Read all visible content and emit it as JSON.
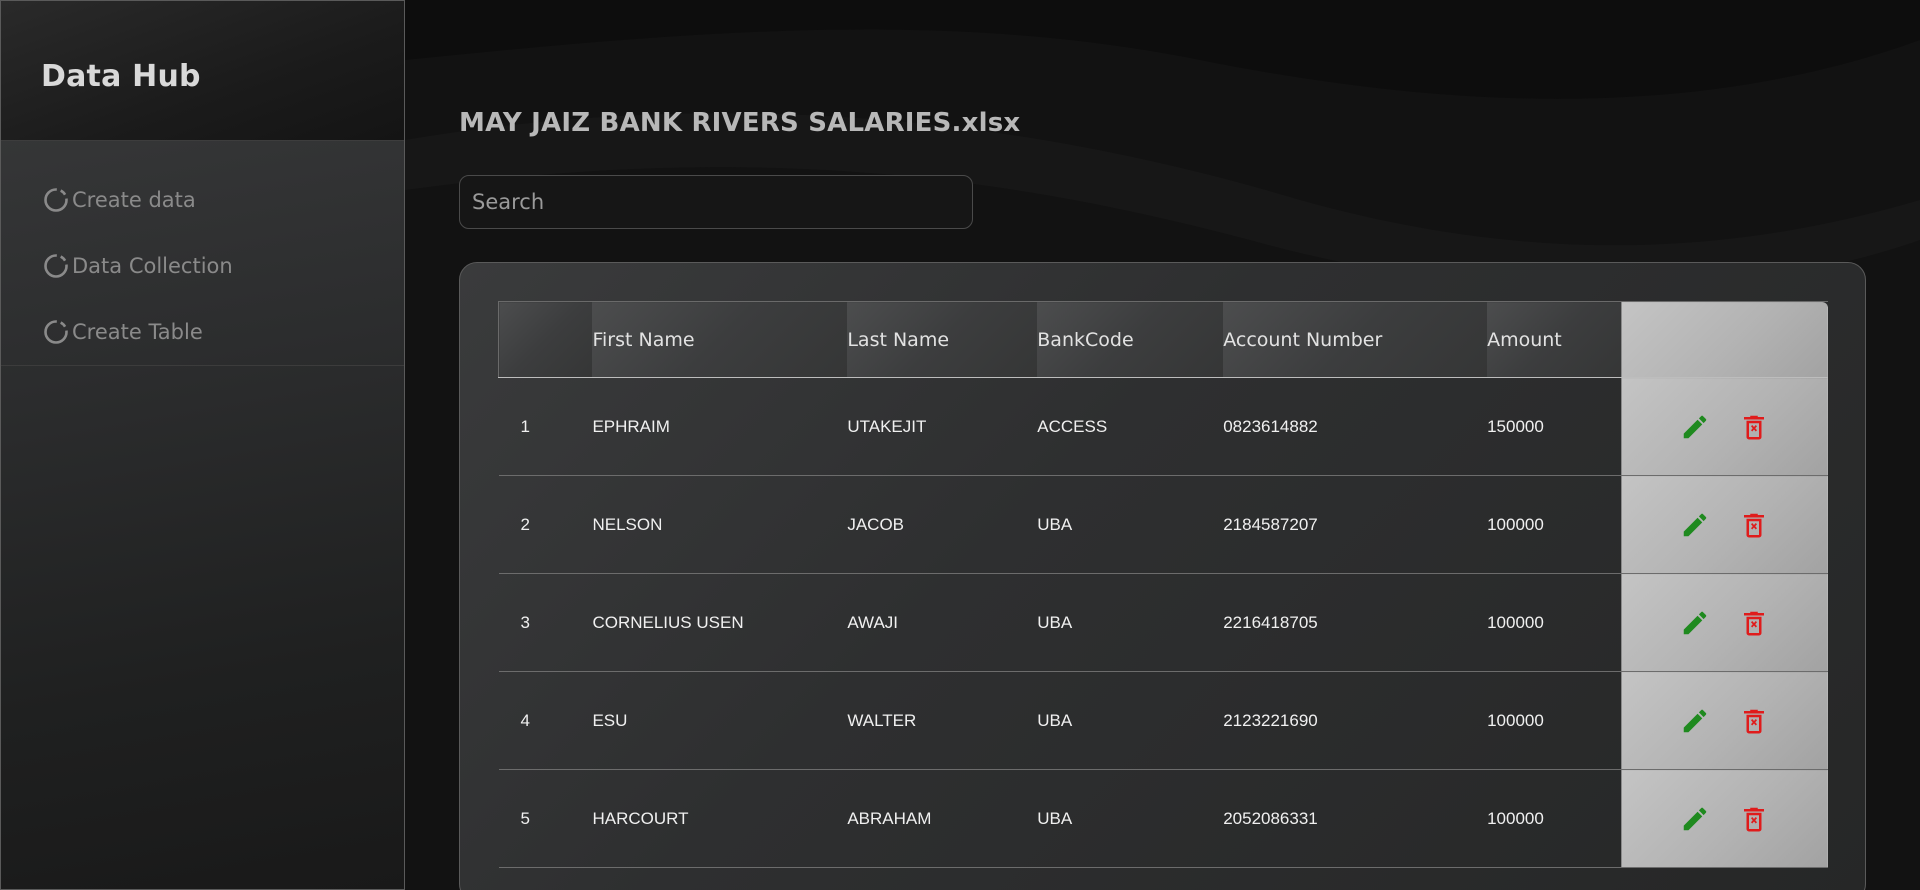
{
  "sidebar": {
    "brand": "Data Hub",
    "items": [
      {
        "label": "Create data",
        "icon": "loading-circle-icon"
      },
      {
        "label": "Data Collection",
        "icon": "loading-circle-icon"
      },
      {
        "label": "Create Table",
        "icon": "loading-circle-icon"
      }
    ]
  },
  "main": {
    "file_title": "MAY JAIZ BANK RIVERS SALARIES.xlsx",
    "search": {
      "placeholder": "Search",
      "value": ""
    },
    "table": {
      "columns": [
        "",
        "First Name",
        "Last Name",
        "BankCode",
        "Account Number",
        "Amount",
        ""
      ],
      "rows": [
        {
          "index": "1",
          "first": "EPHRAIM",
          "last": "UTAKEJIT",
          "bank": "ACCESS",
          "account": "0823614882",
          "amount": "150000"
        },
        {
          "index": "2",
          "first": "NELSON",
          "last": "JACOB",
          "bank": "UBA",
          "account": "2184587207",
          "amount": "100000"
        },
        {
          "index": "3",
          "first": "CORNELIUS USEN",
          "last": "AWAJI",
          "bank": "UBA",
          "account": "2216418705",
          "amount": "100000"
        },
        {
          "index": "4",
          "first": "ESU",
          "last": "WALTER",
          "bank": "UBA",
          "account": "2123221690",
          "amount": "100000"
        },
        {
          "index": "5",
          "first": "HARCOURT",
          "last": "ABRAHAM",
          "bank": "UBA",
          "account": "2052086331",
          "amount": "100000"
        }
      ],
      "row_actions": {
        "edit_icon": "pencil-icon",
        "delete_icon": "trash-icon"
      }
    }
  },
  "colors": {
    "edit": "#1f8a1f",
    "delete": "#e01b1b",
    "background": "#121212"
  }
}
